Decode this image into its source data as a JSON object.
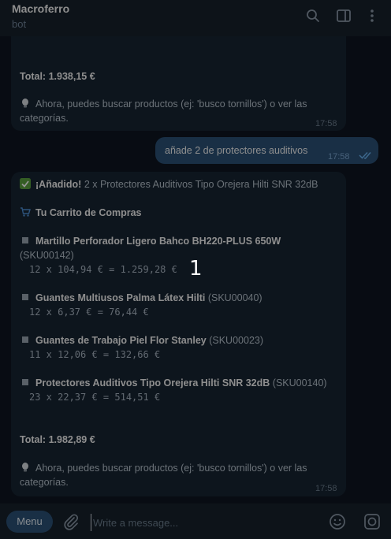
{
  "header": {
    "title": "Macroferro",
    "subtitle": "bot"
  },
  "prev_message": {
    "total": "Total: 1.938,15 €",
    "hint": "Ahora, puedes buscar productos (ej: 'busco tornillos') o ver las",
    "hint2": "categorías.",
    "time": "17:58"
  },
  "user_message": {
    "text": "añade 2 de protectores auditivos",
    "time": "17:58"
  },
  "bot_message": {
    "added_bold": "¡Añadido!",
    "added_rest": "2 x Protectores Auditivos Tipo Orejera Hilti SNR 32dB",
    "cart_title": "Tu Carrito de Compras",
    "items": [
      {
        "name": "Martillo Perforador Ligero Bahco BH220-PLUS 650W",
        "sku": "(SKU00142)",
        "calc": "12 x 104,94 € = 1.259,28 €"
      },
      {
        "name": "Guantes Multiusos Palma Látex Hilti",
        "sku": "(SKU00040)",
        "calc": "12 x 6,37 € = 76,44 €"
      },
      {
        "name": "Guantes de Trabajo Piel Flor Stanley",
        "sku": "(SKU00023)",
        "calc": "11 x 12,06 € = 132,66 €"
      },
      {
        "name": "Protectores Auditivos Tipo Orejera Hilti SNR 32dB",
        "sku": "(SKU00140)",
        "calc": "23 x 22,37 € = 514,51 €"
      }
    ],
    "total": "Total: 1.982,89 €",
    "hint": "Ahora, puedes buscar productos (ej: 'busco tornillos') o ver las",
    "hint2": "categorías.",
    "time": "17:58"
  },
  "overlay_marker": "1",
  "composer": {
    "menu_label": "Menu",
    "placeholder": "Write a message..."
  },
  "colors": {
    "background": "#0e1621",
    "bubble_in": "#182533",
    "bubble_out": "#2b5278",
    "header": "#17212b"
  }
}
